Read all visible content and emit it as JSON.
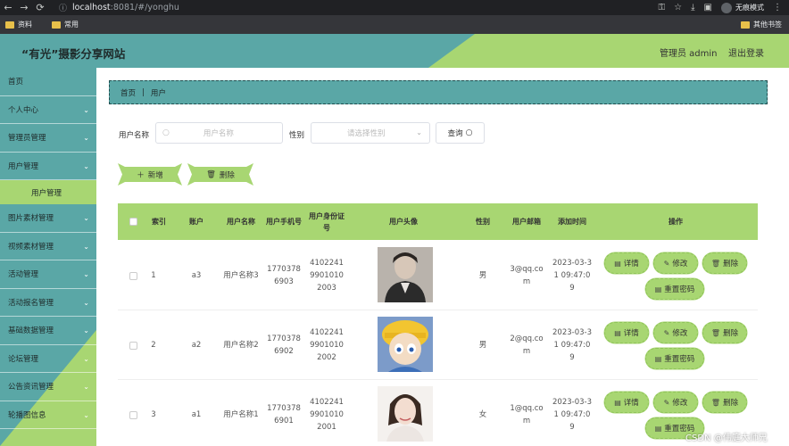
{
  "browser": {
    "url_host": "localhost",
    "url_path": ":8081/#/yonghu",
    "incognito_label": "无痕模式",
    "bookmarks": [
      "资料",
      "常用"
    ],
    "other_bookmarks": "其他书签"
  },
  "header": {
    "title": "“有光”摄影分享网站",
    "admin": "管理员 admin",
    "logout": "退出登录"
  },
  "sidebar": {
    "items": [
      {
        "label": "首页",
        "chevron": false
      },
      {
        "label": "个人中心",
        "chevron": true
      },
      {
        "label": "管理员管理",
        "chevron": true
      },
      {
        "label": "用户管理",
        "chevron": true
      },
      {
        "label": "用户管理",
        "sub": true
      },
      {
        "label": "图片素材管理",
        "chevron": true
      },
      {
        "label": "视频素材管理",
        "chevron": true
      },
      {
        "label": "活动管理",
        "chevron": true
      },
      {
        "label": "活动报名管理",
        "chevron": true
      },
      {
        "label": "基础数据管理",
        "chevron": true
      },
      {
        "label": "论坛管理",
        "chevron": true
      },
      {
        "label": "公告资讯管理",
        "chevron": true
      },
      {
        "label": "轮播图信息",
        "chevron": true
      }
    ]
  },
  "breadcrumb": {
    "home": "首页",
    "current": "用户"
  },
  "search": {
    "name_label": "用户名称",
    "name_placeholder": "用户名称",
    "gender_label": "性别",
    "gender_placeholder": "请选择性别",
    "query_label": "查询"
  },
  "actions": {
    "add_label": "新增",
    "delete_label": "删除"
  },
  "table": {
    "headers": {
      "index": "索引",
      "account": "账户",
      "name": "用户名称",
      "phone": "用户手机号",
      "id_card": "用户身份证号",
      "avatar": "用户头像",
      "gender": "性别",
      "email": "用户邮箱",
      "time": "添加时间",
      "ops": "操作"
    },
    "row_buttons": {
      "detail": "详情",
      "edit": "修改",
      "delete": "删除",
      "reset": "重置密码"
    },
    "rows": [
      {
        "index": "1",
        "account": "a3",
        "name": "用户名称3",
        "phone": "17703786903",
        "id_card": "410224199010102003",
        "gender": "男",
        "email": "3@qq.com",
        "time": "2023-03-31 09:47:09"
      },
      {
        "index": "2",
        "account": "a2",
        "name": "用户名称2",
        "phone": "17703786902",
        "id_card": "410224199010102002",
        "gender": "男",
        "email": "2@qq.com",
        "time": "2023-03-31 09:47:09"
      },
      {
        "index": "3",
        "account": "a1",
        "name": "用户名称1",
        "phone": "17703786901",
        "id_card": "410224199010102001",
        "gender": "女",
        "email": "1@qq.com",
        "time": "2023-03-31 09:47:09"
      }
    ]
  },
  "watermark": "CSDN @伟庭大师兄",
  "colors": {
    "teal": "#5aa7a6",
    "green": "#a8d672"
  }
}
